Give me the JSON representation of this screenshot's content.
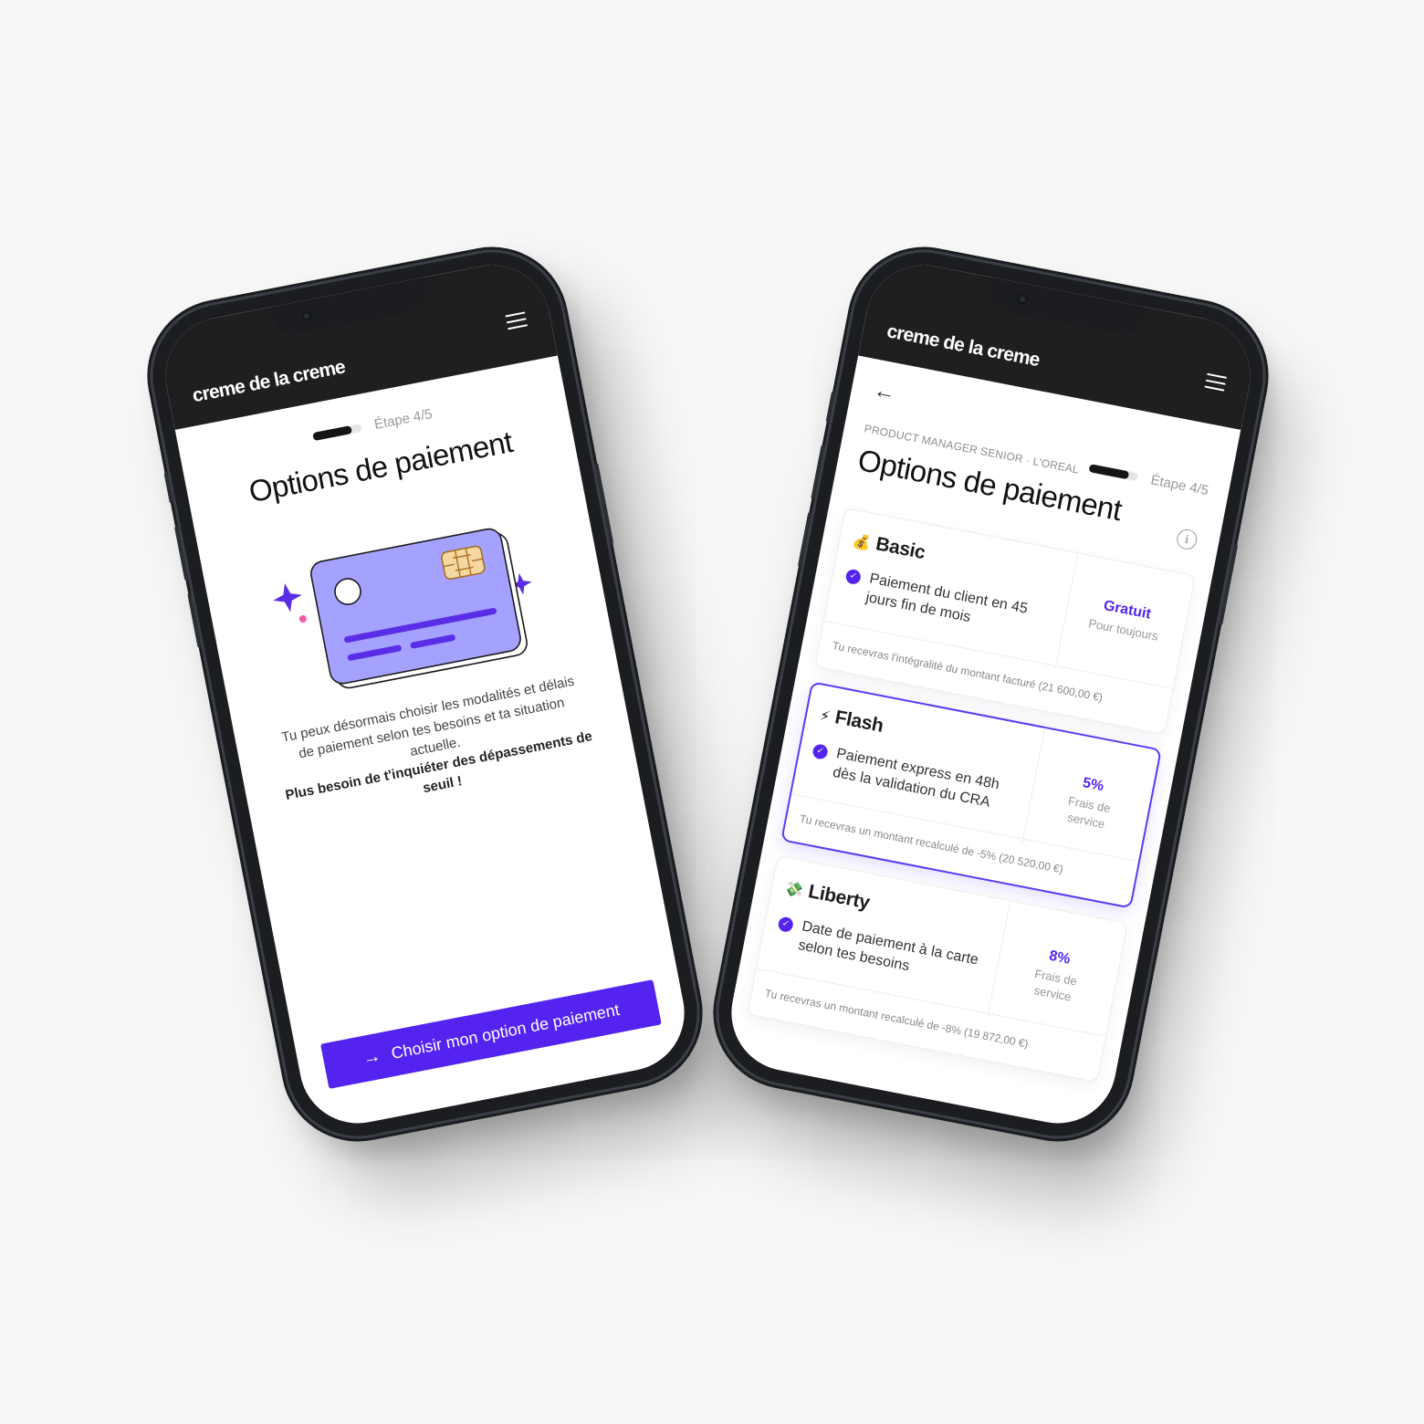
{
  "colors": {
    "accent": "#5423f0",
    "header_bg": "#1f1f1f",
    "card_purple": "#a5a2ff",
    "sparkle_purple": "#5a2ee6",
    "sparkle_pink": "#f05aa8"
  },
  "left_phone": {
    "logo": "creme de la creme",
    "menu_icon": "hamburger-icon",
    "progress": {
      "step_label": "Étape 4/5",
      "fraction": 0.8
    },
    "title": "Options de paiement",
    "illustration": "credit-card-icon",
    "description": "Tu peux désormais choisir les modalités et délais de paiement selon tes besoins et ta situation actuelle.",
    "description_bold": "Plus besoin de t'inquiéter des dépassements de seuil !",
    "cta_icon": "arrow-right-icon",
    "cta_label": "Choisir mon option de paiement"
  },
  "right_phone": {
    "logo": "creme de la creme",
    "menu_icon": "hamburger-icon",
    "back_icon": "arrow-left-icon",
    "eyebrow": "PRODUCT MANAGER SENIOR · L'OREAL",
    "progress": {
      "step_label": "Étape 4/5",
      "fraction": 0.8
    },
    "title": "Options de paiement",
    "info_icon": "info-icon",
    "options": [
      {
        "emoji": "💰",
        "name": "Basic",
        "description": "Paiement du client en 45 jours fin de mois",
        "price": "Gratuit",
        "price_sub": "Pour toujours",
        "footer": "Tu recevras l'intégralité du montant facturé (21 600,00 €)",
        "selected": false
      },
      {
        "emoji": "⚡",
        "name": "Flash",
        "description": "Paiement express en 48h dès la validation du CRA",
        "price": "5%",
        "price_sub": "Frais de service",
        "footer": "Tu recevras un montant recalculé de -5% (20 520,00 €)",
        "selected": true
      },
      {
        "emoji": "💸",
        "name": "Liberty",
        "description": "Date de paiement à la carte selon tes besoins",
        "price": "8%",
        "price_sub": "Frais de service",
        "footer": "Tu recevras un montant recalculé de -8% (19 872,00 €)",
        "selected": false
      }
    ]
  }
}
